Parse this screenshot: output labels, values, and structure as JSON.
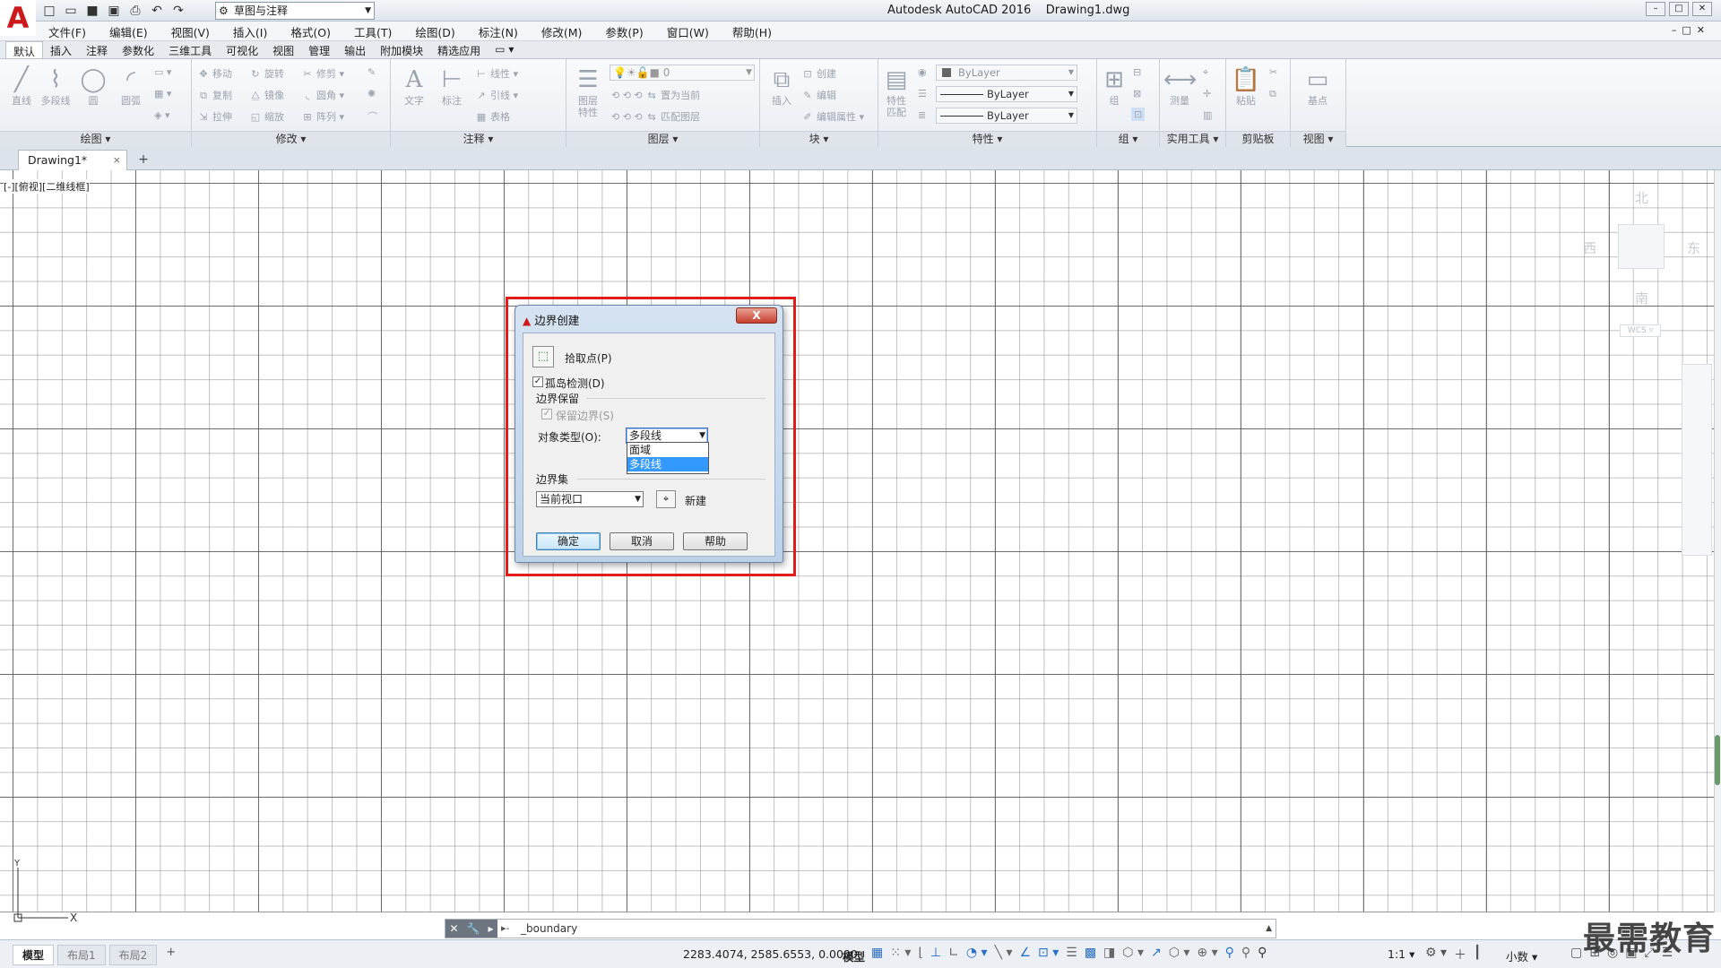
{
  "app": {
    "logo": "A",
    "title": "Autodesk AutoCAD 2016    Drawing1.dwg",
    "workspace": "草图与注释",
    "quick_access_icons": [
      "new-icon",
      "open-icon",
      "save-icon",
      "save-as-icon",
      "print-icon",
      "undo-icon",
      "redo-icon"
    ]
  },
  "menu": {
    "items": [
      "文件(F)",
      "编辑(E)",
      "视图(V)",
      "插入(I)",
      "格式(O)",
      "工具(T)",
      "绘图(D)",
      "标注(N)",
      "修改(M)",
      "参数(P)",
      "窗口(W)",
      "帮助(H)"
    ]
  },
  "ribbon": {
    "tabs": [
      "默认",
      "插入",
      "注释",
      "参数化",
      "三维工具",
      "可视化",
      "视图",
      "管理",
      "输出",
      "附加模块",
      "精选应用"
    ],
    "active_tab": "默认",
    "draw": {
      "title": "绘图",
      "tools": [
        "直线",
        "多段线",
        "圆",
        "圆弧"
      ]
    },
    "modify": {
      "title": "修改",
      "tools": [
        "移动",
        "旋转",
        "修剪",
        "复制",
        "镜像",
        "圆角",
        "拉伸",
        "缩放",
        "阵列"
      ]
    },
    "annotation": {
      "title": "注释",
      "tools": [
        "文字",
        "标注",
        "线性",
        "引线",
        "表格"
      ]
    },
    "layers": {
      "title": "图层",
      "big_tool": "图层特性",
      "current_layer": "0",
      "tools": [
        "置为当前",
        "匹配图层"
      ]
    },
    "block": {
      "title": "块",
      "big_tool": "插入",
      "tools": [
        "创建",
        "编辑",
        "编辑属性"
      ]
    },
    "properties": {
      "title": "特性",
      "big_tool": "特性匹配",
      "color": "ByLayer",
      "linetype": "ByLayer",
      "lineweight": "ByLayer"
    },
    "groups": {
      "title": "组",
      "big_tool": "组"
    },
    "utilities": {
      "title": "实用工具",
      "big_tool": "测量"
    },
    "clipboard": {
      "title": "剪贴板",
      "big_tool": "粘贴"
    },
    "view": {
      "title": "视图",
      "big_tool": "基点"
    }
  },
  "file_tab": {
    "name": "Drawing1*",
    "close": "×",
    "add": "+"
  },
  "viewport": {
    "label": "[-][俯视][二维线框]"
  },
  "viewcube": {
    "north": "北",
    "south": "南",
    "east": "东",
    "west": "西",
    "wcs": "WCS"
  },
  "dialog": {
    "title": "边界创建",
    "close": "X",
    "pick_points": "拾取点(P)",
    "island_detection": {
      "label": "孤岛检测(D)",
      "checked": true
    },
    "boundary_retention": {
      "heading": "边界保留",
      "retain": {
        "label": "保留边界(S)",
        "checked": true,
        "disabled": true
      },
      "object_type_label": "对象类型(O):",
      "object_type_value": "多段线",
      "options": [
        "面域",
        "多段线"
      ],
      "selected_option": "多段线"
    },
    "boundary_set": {
      "heading": "边界集",
      "value": "当前视口",
      "new_label": "新建"
    },
    "buttons": {
      "ok": "确定",
      "cancel": "取消",
      "help": "帮助"
    }
  },
  "command_line": {
    "prompt_icon": "command-prompt-icon",
    "text": "_boundary"
  },
  "status_bar": {
    "layout_tabs": [
      "模型",
      "布局1",
      "布局2"
    ],
    "active_layout": "模型",
    "add": "+",
    "coordinates": "2283.4074, 2585.6553, 0.0000",
    "mode": "模型",
    "annotation_scale": "1:1",
    "units": "小数"
  },
  "watermark": "最需教育",
  "colors": {
    "highlight": "#e21b1b",
    "logo": "#cc1a1a",
    "selection": "#3399ff"
  }
}
